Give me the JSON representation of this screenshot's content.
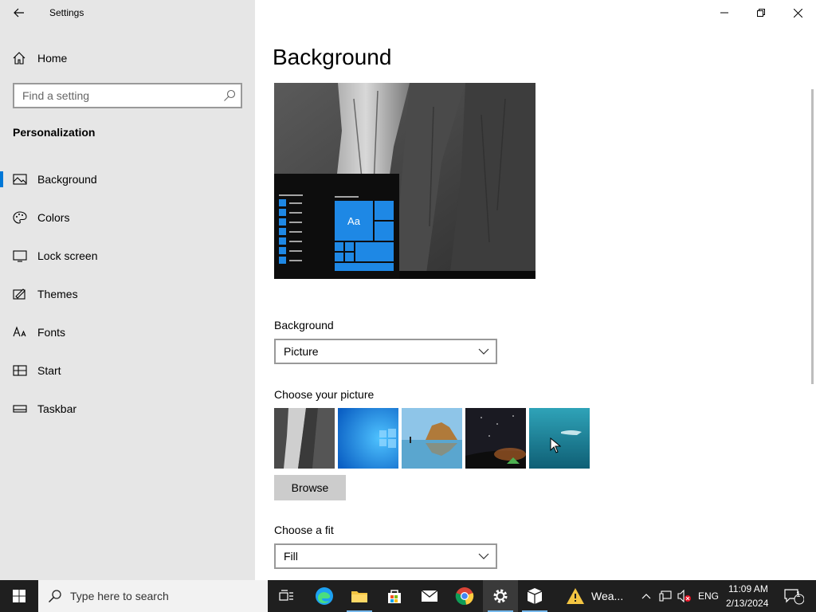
{
  "window": {
    "title": "Settings",
    "controls": [
      "minimize",
      "restore",
      "close"
    ]
  },
  "sidebar": {
    "home_label": "Home",
    "search_placeholder": "Find a setting",
    "section_title": "Personalization",
    "items": [
      {
        "label": "Background",
        "icon": "picture-icon",
        "active": true
      },
      {
        "label": "Colors",
        "icon": "palette-icon",
        "active": false
      },
      {
        "label": "Lock screen",
        "icon": "lock-screen-icon",
        "active": false
      },
      {
        "label": "Themes",
        "icon": "themes-icon",
        "active": false
      },
      {
        "label": "Fonts",
        "icon": "fonts-icon",
        "active": false
      },
      {
        "label": "Start",
        "icon": "start-icon",
        "active": false
      },
      {
        "label": "Taskbar",
        "icon": "taskbar-icon",
        "active": false
      }
    ]
  },
  "main": {
    "title": "Background",
    "preview_tile_label": "Aa",
    "background_label": "Background",
    "background_value": "Picture",
    "choose_picture_label": "Choose your picture",
    "pictures": [
      "rock-cliff",
      "windows-blue",
      "beach-rocks",
      "night-sky",
      "underwater-swimmer"
    ],
    "browse_label": "Browse",
    "fit_label": "Choose a fit",
    "fit_value": "Fill"
  },
  "taskbar": {
    "search_placeholder": "Type here to search",
    "pinned": [
      "task-view-icon",
      "edge-icon",
      "file-explorer-icon",
      "store-icon",
      "mail-icon",
      "chrome-icon",
      "settings-icon",
      "package-icon",
      "weather-icon"
    ],
    "weather_label": "Wea...",
    "language": "ENG",
    "time": "11:09 AM",
    "date": "2/13/2024",
    "notification_count": "1"
  },
  "colors": {
    "accent": "#0078d7",
    "sidebar_bg": "#e6e6e6",
    "taskbar_bg": "#1f1f1f"
  }
}
